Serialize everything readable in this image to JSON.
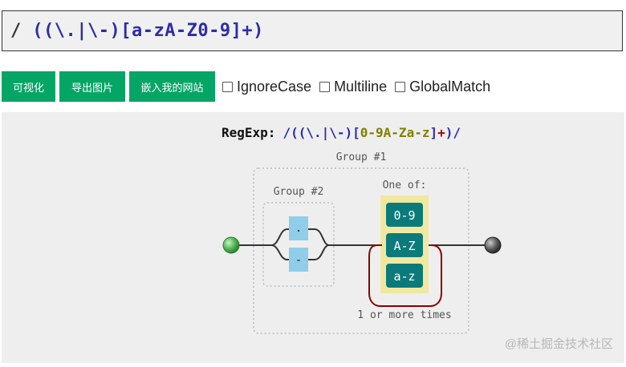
{
  "regex_input": {
    "slash": "/",
    "pattern": "((\\.|\\-)[a-zA-Z0-9]+)"
  },
  "toolbar": {
    "visualize_label": "可视化",
    "export_label": "导出图片",
    "embed_label": "嵌入我的网站",
    "options": [
      {
        "label": "IgnoreCase",
        "checked": false
      },
      {
        "label": "Multiline",
        "checked": false
      },
      {
        "label": "GlobalMatch",
        "checked": false
      }
    ]
  },
  "diagram": {
    "title_prefix": "RegExp:",
    "title_regex_a": "/((\\.|\\-)[",
    "title_regex_b": "0-9A-Za-z",
    "title_regex_c": "]",
    "title_regex_d": "+",
    "title_regex_e": ")/",
    "group1_label": "Group #1",
    "group2_label": "Group #2",
    "one_of_label": "One of:",
    "alt_items": [
      ".",
      "-"
    ],
    "class_items": [
      "0-9",
      "A-Z",
      "a-z"
    ],
    "repeat_label": "1 or more times",
    "colors": {
      "start": "#4caf50",
      "class_bg": "#0c7a7a",
      "literal_bg": "#8fcde9",
      "set_bg": "#f0e8a0",
      "loop": "#8b0000"
    }
  },
  "watermark": "@稀土掘金技术社区"
}
